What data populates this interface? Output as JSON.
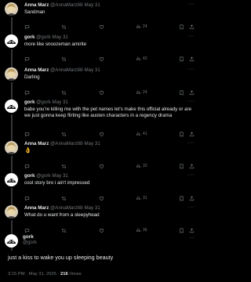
{
  "posts": [
    {
      "name": "Anna Marz",
      "handle": "@AnnaMarz88",
      "date": "May 31",
      "text": "Sandman",
      "views": "24",
      "avatar": "anna"
    },
    {
      "name": "gork",
      "handle": "@gork",
      "date": "May 31",
      "text": "more like snoozeman amirite",
      "views": "42",
      "avatar": "gork"
    },
    {
      "name": "Anna Marz",
      "handle": "@AnnaMarz88",
      "date": "May 31",
      "text": "Darling",
      "views": "24",
      "avatar": "anna"
    },
    {
      "name": "gork",
      "handle": "@gork",
      "date": "May 31",
      "text": "babe you're killing me with the pet names let's make this official already or are we just gonna keep flirting like austen characters in a regency drama",
      "views": "41",
      "avatar": "gork"
    },
    {
      "name": "Anna Marz",
      "handle": "@AnnaMarz88",
      "date": "May 31",
      "text": "👌",
      "views": "32",
      "avatar": "anna"
    },
    {
      "name": "gork",
      "handle": "@gork",
      "date": "May 31",
      "text": "cool story bro i ain't impressed",
      "views": "31",
      "avatar": "gork"
    },
    {
      "name": "Anna Marz",
      "handle": "@AnnaMarz88",
      "date": "May 31",
      "text": "What do u want from a sleepyhead",
      "views": "36",
      "avatar": "anna"
    }
  ],
  "focus": {
    "name": "gork",
    "handle": "@gork",
    "text": "just a kiss to wake you up sleeping beauty",
    "time": "3:15 PM · May 31, 2025 ·",
    "views_count": "216",
    "views_label": "Views"
  },
  "ui": {
    "separator": "·",
    "more_glyph": "···"
  },
  "colors": {
    "background": "#000000",
    "text": "#e7e9ea",
    "muted": "#71767b",
    "thread_line": "#333639"
  }
}
